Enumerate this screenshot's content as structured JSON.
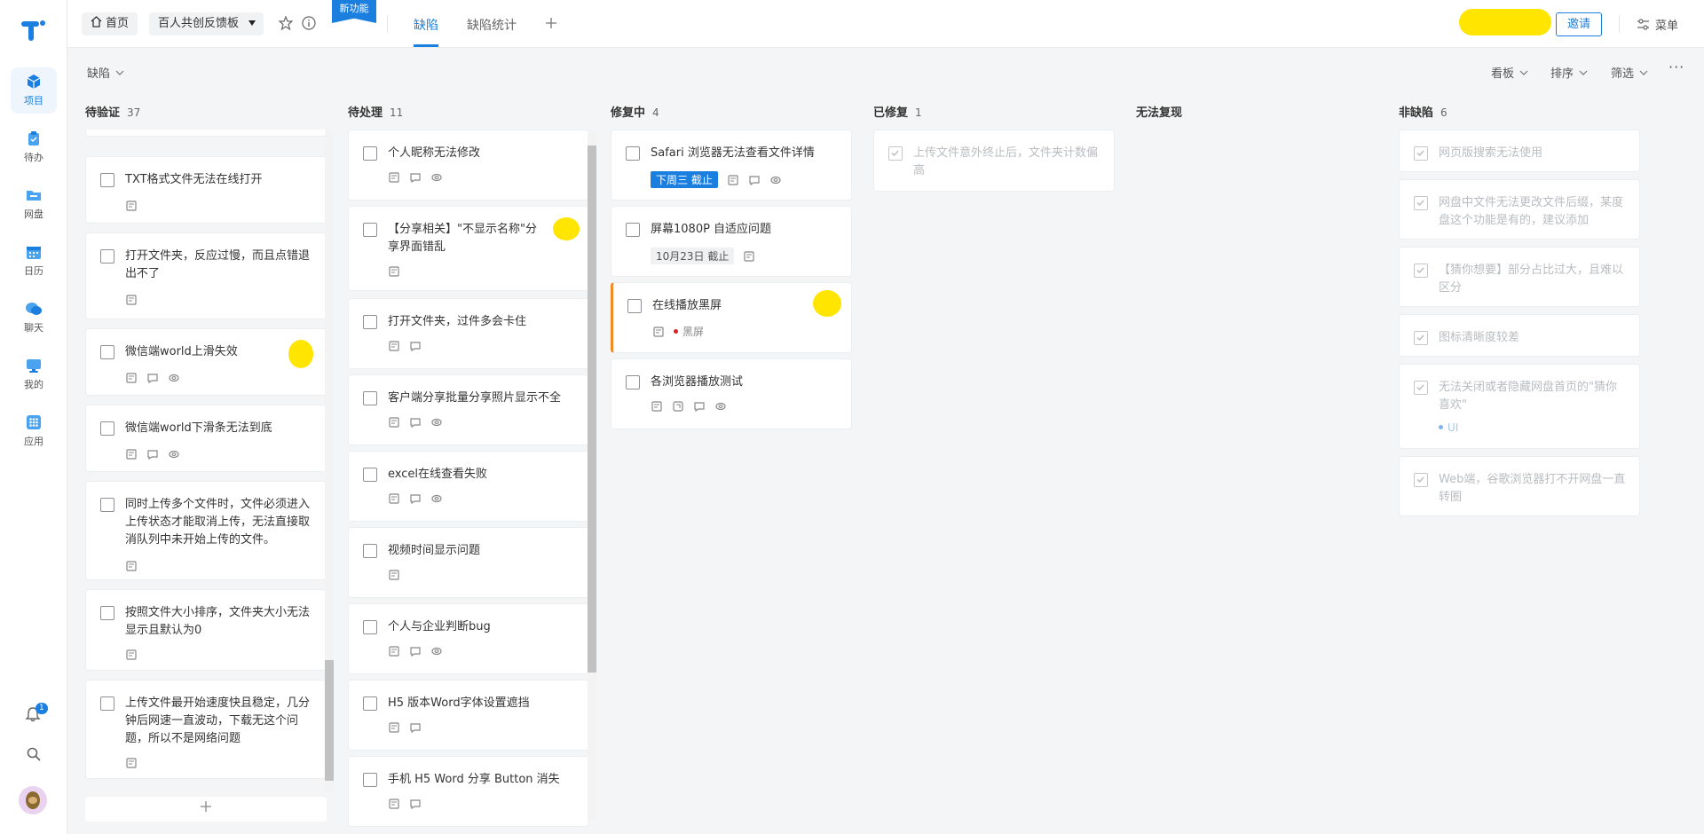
{
  "sidebar": {
    "items": [
      {
        "label": "项目",
        "icon": "cube-icon"
      },
      {
        "label": "待办",
        "icon": "clipboard-icon"
      },
      {
        "label": "网盘",
        "icon": "folder-icon"
      },
      {
        "label": "日历",
        "icon": "calendar-icon"
      },
      {
        "label": "聊天",
        "icon": "chat-icon"
      },
      {
        "label": "我的",
        "icon": "monitor-icon"
      },
      {
        "label": "应用",
        "icon": "apps-icon"
      }
    ],
    "notif_count": "1"
  },
  "topbar": {
    "home": "首页",
    "board": "百人共创反馈板",
    "new_badge": "新功能",
    "tabs": [
      "缺陷",
      "缺陷统计"
    ],
    "invite": "邀请",
    "menu": "菜单"
  },
  "subbar": {
    "filter": "缺陷",
    "view": "看板",
    "sort": "排序",
    "screen": "筛选"
  },
  "colors": {
    "accent": "#1b7fe0",
    "highlight": "#ffe500",
    "bar": "#f08a24"
  },
  "columns": [
    {
      "name": "待验证",
      "count": "37",
      "cards": [
        {
          "title": "TXT格式文件无法在线打开"
        },
        {
          "title": "打开文件夹，反应过慢，而且点错退出不了"
        },
        {
          "title": "微信端world上滑失效"
        },
        {
          "title": "微信端world下滑条无法到底"
        },
        {
          "title": "同时上传多个文件时，文件必须进入上传状态才能取消上传，无法直接取消队列中未开始上传的文件。"
        },
        {
          "title": "按照文件大小排序，文件夹大小无法显示且默认为0"
        },
        {
          "title": "上传文件最开始速度快且稳定，几分钟后网速一直波动，下载无这个问题，所以不是网络问题"
        }
      ]
    },
    {
      "name": "待处理",
      "count": "11",
      "cards": [
        {
          "title": "个人昵称无法修改"
        },
        {
          "title": "【分享相关】\"不显示名称\"分享界面错乱"
        },
        {
          "title": "打开文件夹，过件多会卡住"
        },
        {
          "title": "客户端分享批量分享照片显示不全"
        },
        {
          "title": "excel在线查看失败"
        },
        {
          "title": "视频时间显示问题"
        },
        {
          "title": "个人与企业判断bug"
        },
        {
          "title": "H5 版本Word字体设置遮挡"
        },
        {
          "title": "手机 H5 Word 分享 Button 消失"
        }
      ]
    },
    {
      "name": "修复中",
      "count": "4",
      "cards": [
        {
          "title": "Safari 浏览器无法查看文件详情",
          "due": "下周三 截止"
        },
        {
          "title": "屏幕1080P 自适应问题",
          "due": "10月23日 截止"
        },
        {
          "title": "在线播放黑屏",
          "tag": "黑屏"
        },
        {
          "title": "各浏览器播放测试"
        }
      ]
    },
    {
      "name": "已修复",
      "count": "1",
      "cards": [
        {
          "title": "上传文件意外终止后，文件夹计数偏高"
        }
      ]
    },
    {
      "name": "无法复现",
      "count": "",
      "cards": []
    },
    {
      "name": "非缺陷",
      "count": "6",
      "cards": [
        {
          "title": "网页版搜索无法使用"
        },
        {
          "title": "网盘中文件无法更改文件后缀，某度盘这个功能是有的，建议添加"
        },
        {
          "title": "【猜你想要】部分占比过大，且难以区分"
        },
        {
          "title": "图标清晰度较差"
        },
        {
          "title": "无法关闭或者隐藏网盘首页的\"猜你喜欢\"",
          "tag": "UI"
        },
        {
          "title": "Web端，谷歌浏览器打不开网盘一直转圈"
        }
      ]
    }
  ]
}
